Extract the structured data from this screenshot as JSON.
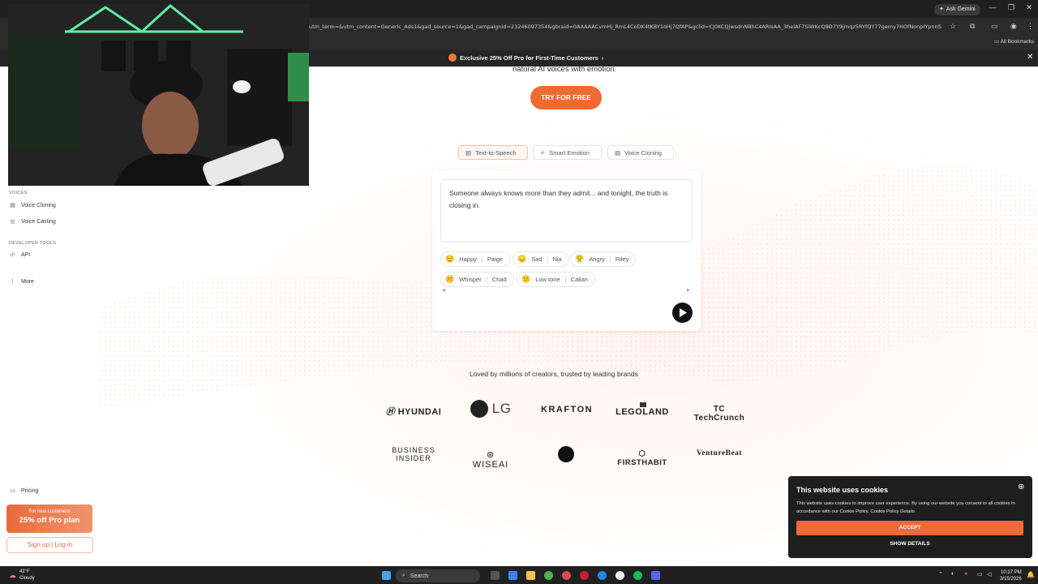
{
  "browser": {
    "ask_gemini": "Ask Gemini",
    "url": "utm_term=&utm_content=Generic_Ads1&gad_source=1&gad_campaignid=23246097354&gbraid=0AAAAACvmHj_RmL4CoDK4tKBY1oHj7QfAP&gclid=Cj0KCQjwsdnNBhC4ARIsAA_3heiAF7SiWKcQ9D7Y9jmqz5RYfQY77gemy7HOfNonpIYpnnSdkaX1OYa...",
    "all_bookmarks": "All Bookmarks",
    "promo_banner": "Exclusive 25% Off Pro for First-Time Customers"
  },
  "sidebar": {
    "voices_heading": "VOICES",
    "voices_items": [
      {
        "label": "Voice Cloning",
        "icon": "voice-cloning-icon"
      },
      {
        "label": "Voice Casting",
        "icon": "voice-casting-icon"
      }
    ],
    "dev_heading": "DEVELOPER TOOLS",
    "dev_items": [
      {
        "label": "API",
        "icon": "code-icon"
      }
    ],
    "more": "More",
    "pricing": "Pricing",
    "promo_line1": "For new customers",
    "promo_line2": "25% off Pro plan",
    "signup": "Sign up | Log in"
  },
  "hero": {
    "tagline": "natural AI voices with emotion.",
    "cta": "TRY FOR FREE"
  },
  "tabs": [
    {
      "label": "Text-to-Speech",
      "icon": "text-to-speech-icon"
    },
    {
      "label": "Smart Emotion",
      "icon": "sparkle-icon"
    },
    {
      "label": "Voice Cloning",
      "icon": "voice-cloning-icon"
    }
  ],
  "demo": {
    "text": "Someone always knows more than they admit... and tonight, the truth is closing in.",
    "chips": [
      {
        "emotion": "Happy",
        "voice": "Paige",
        "emoji": "😌"
      },
      {
        "emotion": "Sad",
        "voice": "Nia",
        "emoji": "😞"
      },
      {
        "emotion": "Angry",
        "voice": "Riley",
        "emoji": "😤"
      },
      {
        "emotion": "Whisper",
        "voice": "Chad",
        "emoji": "🤫"
      },
      {
        "emotion": "Low tone",
        "voice": "Callan",
        "emoji": "😕"
      }
    ]
  },
  "brands": {
    "heading": "Loved by millions of creators, trusted by leading brands",
    "row1": [
      "HYUNDAI",
      "LG",
      "KRAFTON",
      "LEGOLAND",
      "TechCrunch"
    ],
    "row2": [
      "BUSINESS INSIDER",
      "WISEAI",
      "",
      "FIRSTHABIT",
      "VentureBeat"
    ],
    "tc_prefix": "TC"
  },
  "cookie": {
    "title": "This website uses cookies",
    "text": "This website uses cookies to improve user experience. By using our website you consent to all cookies in accordance with our Cookie Policy. Cookie Policy Details",
    "accept": "ACCEPT",
    "details": "SHOW DETAILS"
  },
  "taskbar": {
    "temp": "42°F",
    "weather": "Cloudy",
    "search": "Search",
    "time": "10:37 PM",
    "date": "3/15/2026"
  }
}
